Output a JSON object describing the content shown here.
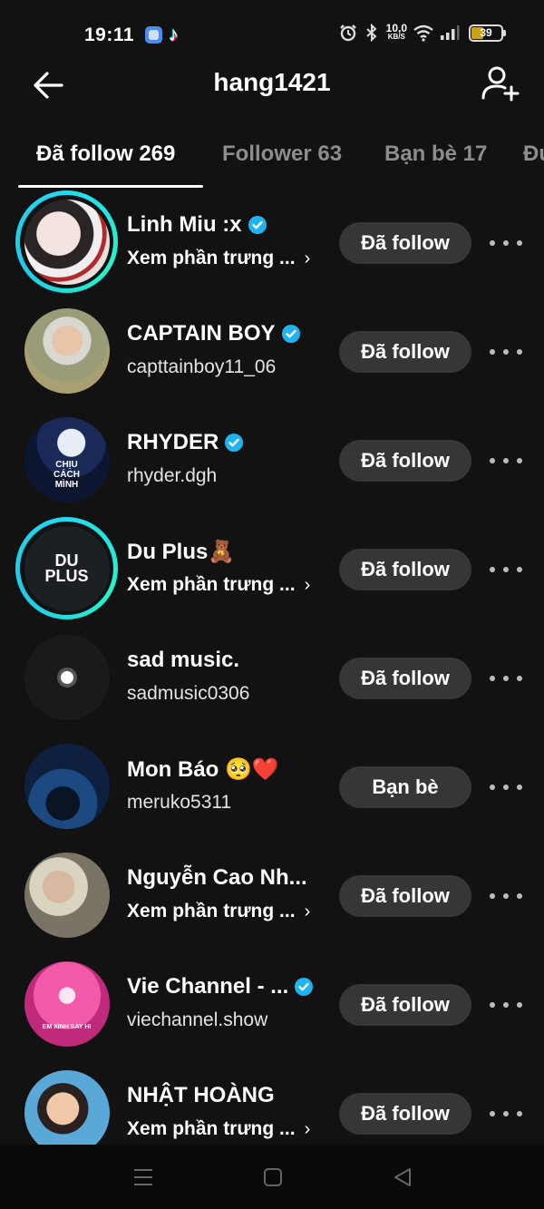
{
  "status_bar": {
    "time": "19:11",
    "network_speed_value": "10,0",
    "network_speed_unit": "KB/S",
    "battery_level": "39"
  },
  "header": {
    "title": "hang1421",
    "back_icon": "arrow-left-icon",
    "add_user_icon": "add-user-icon"
  },
  "tabs": [
    {
      "label": "Đã follow 269",
      "active": true
    },
    {
      "label": "Follower 63",
      "active": false
    },
    {
      "label": "Bạn bè 17",
      "active": false
    },
    {
      "label": "Đu",
      "active": false
    }
  ],
  "users": [
    {
      "name": "Linh Miu :x",
      "verified": true,
      "subtitle": "Xem phần trưng ...",
      "subtitle_link": true,
      "story": true,
      "button": "Đã follow"
    },
    {
      "name": "CAPTAIN BOY",
      "verified": true,
      "subtitle": "capttainboy11_06",
      "subtitle_link": false,
      "story": false,
      "button": "Đã follow"
    },
    {
      "name": "RHYDER",
      "verified": true,
      "subtitle": "rhyder.dgh",
      "subtitle_link": false,
      "story": false,
      "button": "Đã follow",
      "avatar_text": "CHỊU CÁCH MÌNH"
    },
    {
      "name": "Du Plus🧸",
      "verified": false,
      "subtitle": "Xem phần trưng ...",
      "subtitle_link": true,
      "story": true,
      "button": "Đã follow",
      "avatar_text": "DU PLUS"
    },
    {
      "name": "sad music.",
      "verified": false,
      "subtitle": "sadmusic0306",
      "subtitle_link": false,
      "story": false,
      "button": "Đã follow"
    },
    {
      "name": "Mon Báo 🥺❤️",
      "verified": false,
      "subtitle": "meruko5311",
      "subtitle_link": false,
      "story": false,
      "button": "Bạn bè"
    },
    {
      "name": "Nguyễn Cao Nh...",
      "verified": false,
      "subtitle": "Xem phần trưng ...",
      "subtitle_link": true,
      "story": false,
      "button": "Đã follow"
    },
    {
      "name": "Vie Channel - ...",
      "verified": true,
      "subtitle": "viechannel.show",
      "subtitle_link": false,
      "story": false,
      "button": "Đã follow",
      "avatar_text": "EM XINH SAY HI"
    },
    {
      "name": "NHẬT HOÀNG",
      "verified": false,
      "subtitle": "Xem phần trưng ...",
      "subtitle_link": true,
      "story": false,
      "button": "Đã follow"
    }
  ],
  "colors": {
    "background": "#121212",
    "button_bg": "#363636",
    "verified": "#20b3f0",
    "story_ring": "#25d9f0",
    "inactive_tab": "#8d8d8d"
  },
  "nav_bar": {
    "menu_icon": "menu-icon",
    "home_icon": "square-home-icon",
    "back_icon": "triangle-back-icon"
  }
}
